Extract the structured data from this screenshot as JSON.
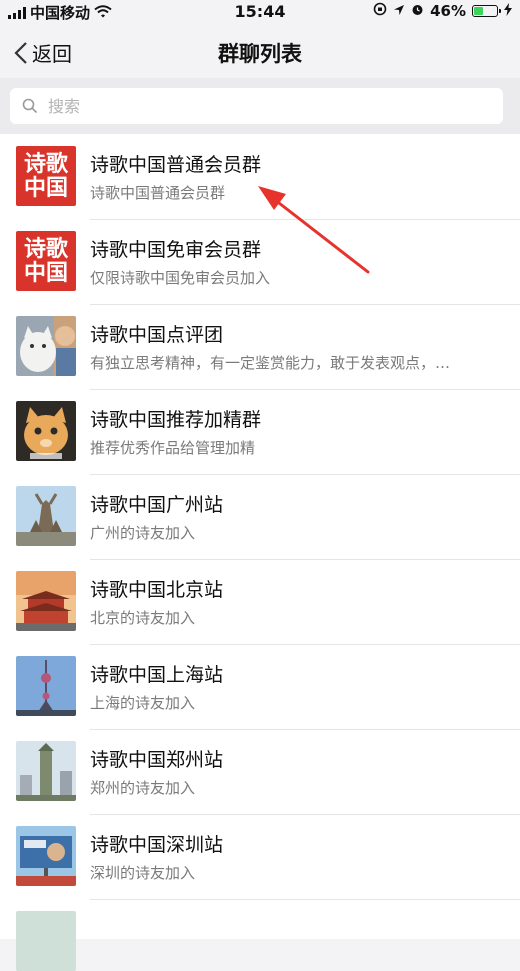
{
  "status": {
    "carrier": "中国移动",
    "time": "15:44",
    "battery": "46%",
    "battery_level": 0.46,
    "battery_color": "#3bd45a"
  },
  "nav": {
    "back_label": "返回",
    "title": "群聊列表"
  },
  "search": {
    "placeholder": "搜索"
  },
  "logo_text": [
    "诗歌",
    "中国"
  ],
  "groups": [
    {
      "name": "诗歌中国普通会员群",
      "desc": "诗歌中国普通会员群",
      "avatar": "logo"
    },
    {
      "name": "诗歌中国免审会员群",
      "desc": "仅限诗歌中国免审会员加入",
      "avatar": "logo"
    },
    {
      "name": "诗歌中国点评团",
      "desc": "有独立思考精神，有一定鉴赏能力，敢于发表观点，…",
      "avatar": "cat-and-child-photo"
    },
    {
      "name": "诗歌中国推荐加精群",
      "desc": "推荐优秀作品给管理加精",
      "avatar": "orange-cat-photo"
    },
    {
      "name": "诗歌中国广州站",
      "desc": "广州的诗友加入",
      "avatar": "guangzhou-statue-photo"
    },
    {
      "name": "诗歌中国北京站",
      "desc": "北京的诗友加入",
      "avatar": "beijing-gate-photo"
    },
    {
      "name": "诗歌中国上海站",
      "desc": "上海的诗友加入",
      "avatar": "shanghai-tower-photo"
    },
    {
      "name": "诗歌中国郑州站",
      "desc": "郑州的诗友加入",
      "avatar": "zhengzhou-tower-photo"
    },
    {
      "name": "诗歌中国深圳站",
      "desc": "深圳的诗友加入",
      "avatar": "shenzhen-billboard-photo"
    }
  ],
  "annotation_color": "#e8322c"
}
